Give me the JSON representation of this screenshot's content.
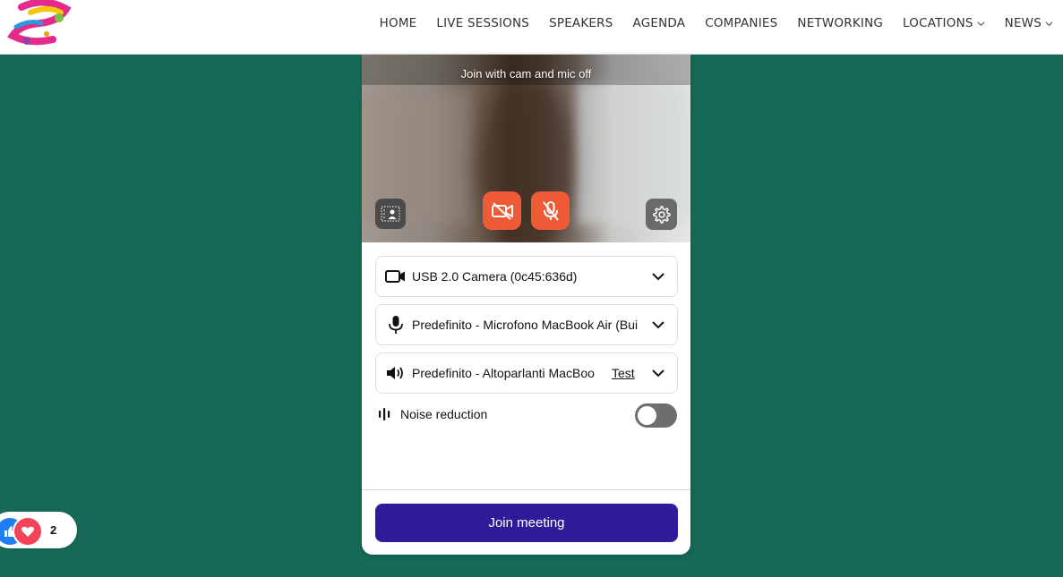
{
  "nav": {
    "items": [
      {
        "label": "HOME",
        "dropdown": false
      },
      {
        "label": "LIVE SESSIONS",
        "dropdown": false
      },
      {
        "label": "SPEAKERS",
        "dropdown": false
      },
      {
        "label": "AGENDA",
        "dropdown": false
      },
      {
        "label": "COMPANIES",
        "dropdown": false
      },
      {
        "label": "NETWORKING",
        "dropdown": false
      },
      {
        "label": "LOCATIONS",
        "dropdown": true
      },
      {
        "label": "NEWS",
        "dropdown": true
      }
    ]
  },
  "preview": {
    "hint": "Join with cam and mic off",
    "camera_state": "off",
    "mic_state": "off"
  },
  "devices": {
    "camera": "USB 2.0 Camera (0c45:636d)",
    "microphone": "Predefinito - Microfono MacBook Air (Bui",
    "speaker": "Predefinito - Altoparlanti MacBoo",
    "test_label": "Test"
  },
  "noise_reduction": {
    "label": "Noise reduction",
    "enabled": false
  },
  "join_button": "Join meeting",
  "reactions": {
    "count": "2"
  },
  "colors": {
    "background": "#166a57",
    "accent": "#2f1a99",
    "media_off": "#f05b37"
  }
}
